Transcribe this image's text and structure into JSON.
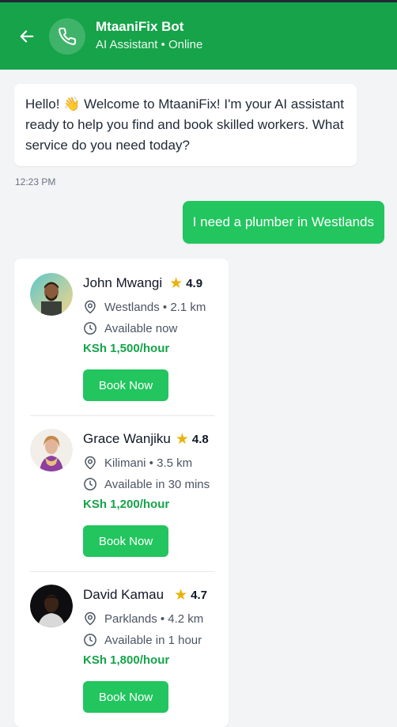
{
  "header": {
    "back_icon": "arrow-left-icon",
    "avatar_icon": "phone-icon",
    "title": "MtaaniFix Bot",
    "subtitle": "AI Assistant • Online",
    "color": "#16a34a"
  },
  "messages": {
    "bot_greeting": "Hello! 👋 Welcome to MtaaniFix! I'm your AI assistant ready to help you find and book skilled workers. What service do you need today?",
    "bot_time": "12:23 PM",
    "user_request": "I need a plumber in Westlands"
  },
  "workers": [
    {
      "name": "John Mwangi",
      "rating": "4.9",
      "location": "Westlands • 2.1 km",
      "availability": "Available now",
      "rate": "KSh 1,500/hour",
      "button": "Book Now"
    },
    {
      "name": "Grace Wanjiku",
      "rating": "4.8",
      "location": "Kilimani • 3.5 km",
      "availability": "Available in 30 mins",
      "rate": "KSh 1,200/hour",
      "button": "Book Now"
    },
    {
      "name": "David Kamau",
      "rating": "4.7",
      "location": "Parklands • 4.2 km",
      "availability": "Available in 1 hour",
      "rate": "KSh 1,800/hour",
      "button": "Book Now"
    }
  ],
  "colors": {
    "accent": "#22c55e",
    "price": "#16a34a",
    "star": "#eab308"
  }
}
